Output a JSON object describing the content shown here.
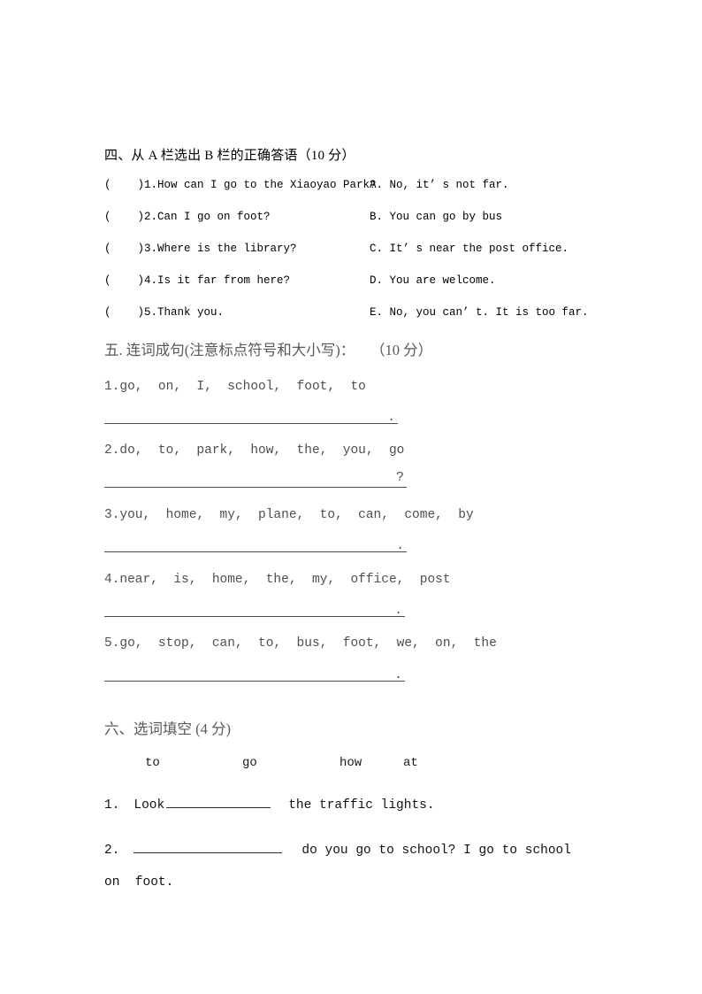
{
  "section4": {
    "heading": "四、从 A 栏选出 B 栏的正确答语（10 分）",
    "rows": [
      {
        "question": "(    )1.How can I go to the Xiaoyao Park?",
        "answer": "A. No, it’ s not far."
      },
      {
        "question": "(    )2.Can I go on foot?",
        "answer": "B. You can go by bus"
      },
      {
        "question": "(    )3.Where is the library?",
        "answer": "C. It’ s near the post office."
      },
      {
        "question": "(    )4.Is it far from here?",
        "answer": "D. You are welcome."
      },
      {
        "question": "(    )5.Thank you.",
        "answer": "E. No, you can’ t. It is too far."
      }
    ]
  },
  "section5": {
    "heading": "五. 连词成句(注意标点符号和大小写)：",
    "points": "（10 分）",
    "items": [
      {
        "words": "1.go,  on,  I,  school,  foot,  to",
        "endmark": "."
      },
      {
        "words": "2.do,  to,  park,  how,  the,  you,  go",
        "endmark": "?"
      },
      {
        "words": "3.you,  home,  my,  plane,  to,  can,  come,  by",
        "endmark": "."
      },
      {
        "words": "4.near,  is,  home,  the,  my,  office,  post",
        "endmark": "."
      },
      {
        "words": "5.go,  stop,  can,  to,  bus,  foot,  we,  on,  the",
        "endmark": "."
      }
    ]
  },
  "section6": {
    "heading": "六、选词填空 (4 分)",
    "wordbank": [
      "to",
      "go",
      "how",
      "at"
    ],
    "q1": {
      "number": "1.",
      "before": "Look",
      "after": "the traffic lights."
    },
    "q2": {
      "number": "2.",
      "after": "do you go to school?   I go to school",
      "continuation": "on  foot."
    }
  }
}
